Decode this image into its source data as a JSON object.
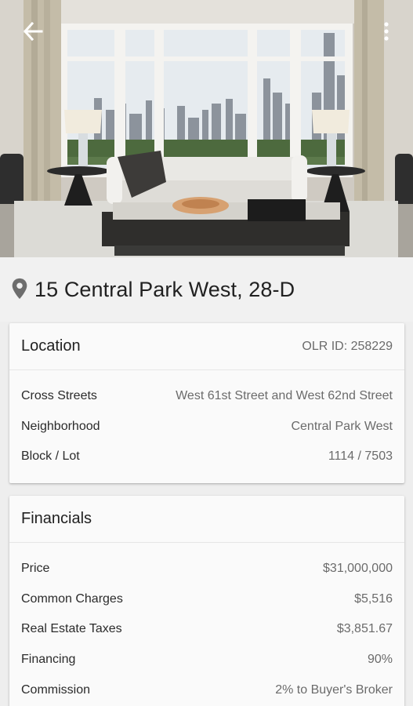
{
  "toolbar": {
    "back_icon": "arrow-left-icon",
    "more_icon": "more-vertical-icon"
  },
  "listing": {
    "address": "15 Central Park West, 28-D",
    "pin_icon": "location-pin-icon"
  },
  "location": {
    "title": "Location",
    "olr_id": "OLR ID: 258229",
    "rows": [
      {
        "label": "Cross Streets",
        "value": "West 61st Street and West 62nd Street"
      },
      {
        "label": "Neighborhood",
        "value": "Central Park West"
      },
      {
        "label": "Block / Lot",
        "value": "1114 / 7503"
      }
    ]
  },
  "financials": {
    "title": "Financials",
    "rows": [
      {
        "label": "Price",
        "value": "$31,000,000"
      },
      {
        "label": "Common Charges",
        "value": "$5,516"
      },
      {
        "label": "Real Estate Taxes",
        "value": "$3,851.67"
      },
      {
        "label": "Financing",
        "value": "90%"
      },
      {
        "label": "Commission",
        "value": "2% to Buyer's Broker"
      }
    ]
  },
  "colors": {
    "background": "#eeeeee",
    "card": "#fafafa",
    "text_primary": "#212121",
    "text_secondary": "#6b6b6b",
    "pin": "#6d6d6d"
  }
}
